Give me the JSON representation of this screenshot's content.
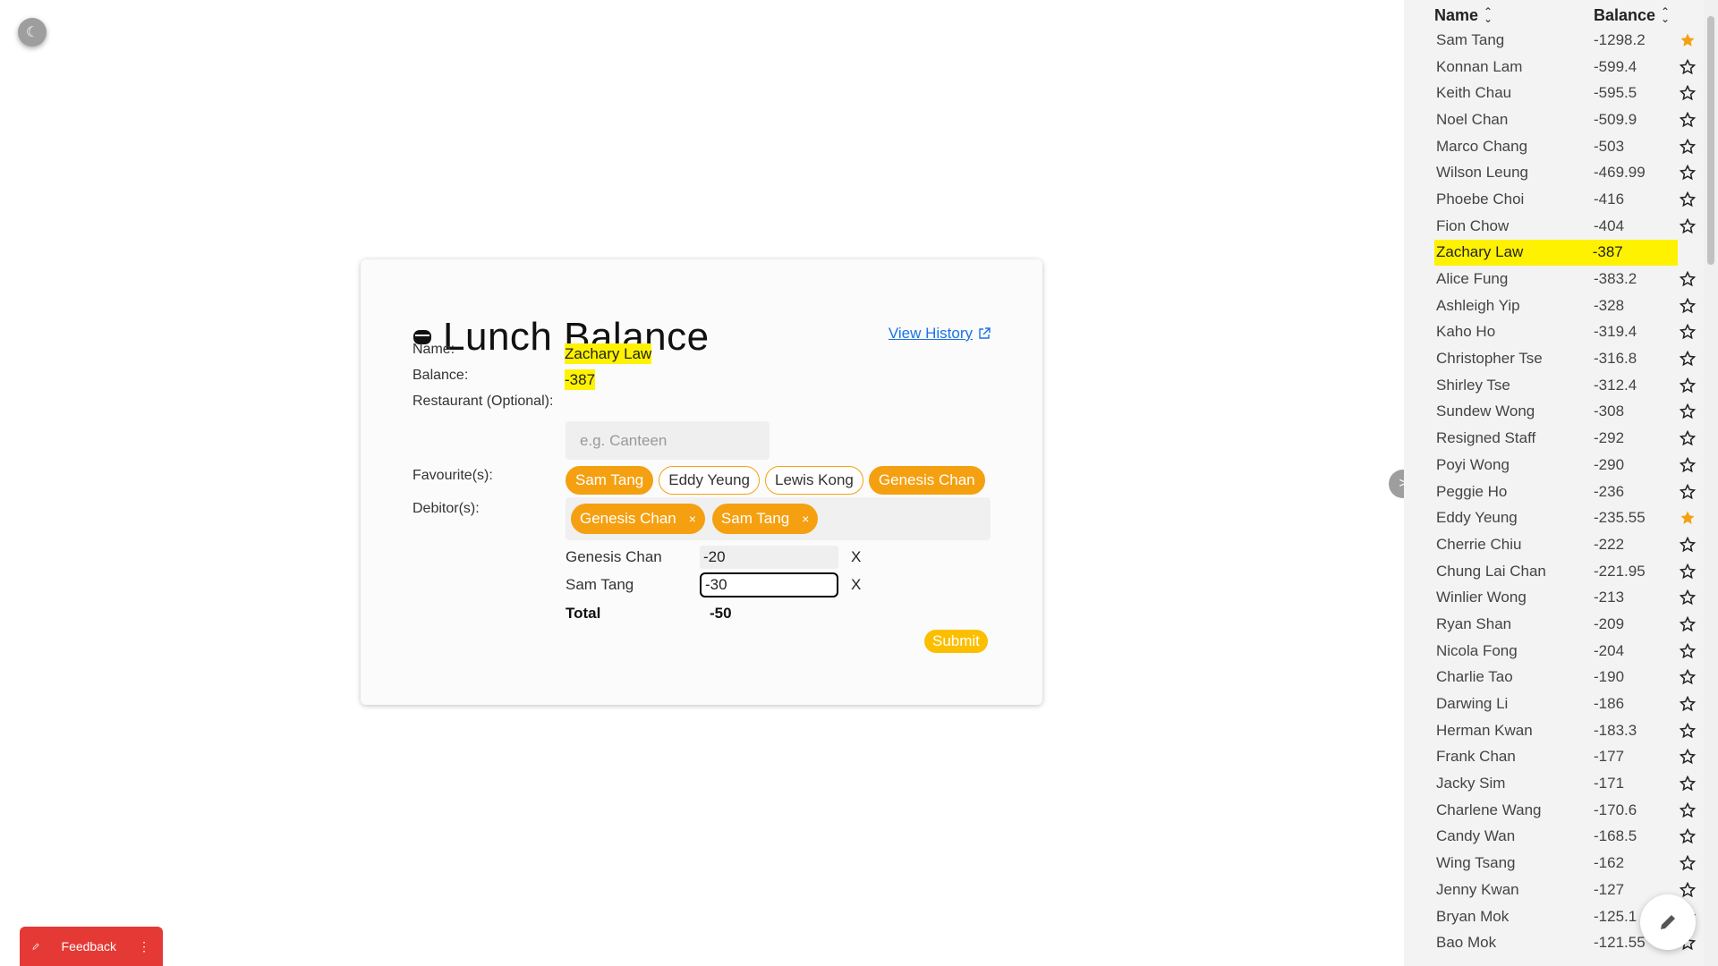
{
  "theme_toggle": {
    "icon": "moon-icon",
    "glyph": "☾"
  },
  "card": {
    "title": "Lunch Balance",
    "history_link": "View History",
    "name_label": "Name:",
    "name_value": "Zachary Law",
    "balance_label": "Balance:",
    "balance_value": "-387",
    "restaurant_label": "Restaurant (Optional):",
    "restaurant_placeholder": "e.g. Canteen",
    "favourites_label": "Favourite(s):",
    "favourites": [
      {
        "label": "Sam Tang",
        "selected": true
      },
      {
        "label": "Eddy Yeung",
        "selected": false
      },
      {
        "label": "Lewis Kong",
        "selected": false
      },
      {
        "label": "Genesis Chan",
        "selected": true
      }
    ],
    "debitors_label": "Debitor(s):",
    "debitors": [
      "Genesis Chan",
      "Sam Tang"
    ],
    "amounts": [
      {
        "name": "Genesis Chan",
        "value": "-20",
        "remove": "X"
      },
      {
        "name": "Sam Tang",
        "value": "-30",
        "remove": "X"
      }
    ],
    "total_label": "Total",
    "total_value": "-50",
    "submit_label": "Submit"
  },
  "side_toggle": {
    "glyph": ">"
  },
  "panel": {
    "header_name": "Name",
    "header_balance": "Balance",
    "rows": [
      {
        "name": "Sam Tang",
        "balance": "-1298.2",
        "star": "filled"
      },
      {
        "name": "Konnan Lam",
        "balance": "-599.4",
        "star": "outline"
      },
      {
        "name": "Keith Chau",
        "balance": "-595.5",
        "star": "outline"
      },
      {
        "name": "Noel Chan",
        "balance": "-509.9",
        "star": "outline"
      },
      {
        "name": "Marco Chang",
        "balance": "-503",
        "star": "outline"
      },
      {
        "name": "Wilson Leung",
        "balance": "-469.99",
        "star": "outline"
      },
      {
        "name": "Phoebe Choi",
        "balance": "-416",
        "star": "outline"
      },
      {
        "name": "Fion Chow",
        "balance": "-404",
        "star": "outline"
      },
      {
        "name": "Zachary Law",
        "balance": "-387",
        "star": "none",
        "selected": true
      },
      {
        "name": "Alice Fung",
        "balance": "-383.2",
        "star": "outline"
      },
      {
        "name": "Ashleigh Yip",
        "balance": "-328",
        "star": "outline"
      },
      {
        "name": "Kaho Ho",
        "balance": "-319.4",
        "star": "outline"
      },
      {
        "name": "Christopher Tse",
        "balance": "-316.8",
        "star": "outline"
      },
      {
        "name": "Shirley Tse",
        "balance": "-312.4",
        "star": "outline"
      },
      {
        "name": "Sundew Wong",
        "balance": "-308",
        "star": "outline"
      },
      {
        "name": "Resigned Staff",
        "balance": "-292",
        "star": "outline"
      },
      {
        "name": "Poyi Wong",
        "balance": "-290",
        "star": "outline"
      },
      {
        "name": "Peggie Ho",
        "balance": "-236",
        "star": "outline"
      },
      {
        "name": "Eddy Yeung",
        "balance": "-235.55",
        "star": "filled"
      },
      {
        "name": "Cherrie Chiu",
        "balance": "-222",
        "star": "outline"
      },
      {
        "name": "Chung Lai Chan",
        "balance": "-221.95",
        "star": "outline"
      },
      {
        "name": "Winlier Wong",
        "balance": "-213",
        "star": "outline"
      },
      {
        "name": "Ryan Shan",
        "balance": "-209",
        "star": "outline"
      },
      {
        "name": "Nicola Fong",
        "balance": "-204",
        "star": "outline"
      },
      {
        "name": "Charlie Tao",
        "balance": "-190",
        "star": "outline"
      },
      {
        "name": "Darwing Li",
        "balance": "-186",
        "star": "outline"
      },
      {
        "name": "Herman Kwan",
        "balance": "-183.3",
        "star": "outline"
      },
      {
        "name": "Frank Chan",
        "balance": "-177",
        "star": "outline"
      },
      {
        "name": "Jacky Sim",
        "balance": "-171",
        "star": "outline"
      },
      {
        "name": "Charlene Wang",
        "balance": "-170.6",
        "star": "outline"
      },
      {
        "name": "Candy Wan",
        "balance": "-168.5",
        "star": "outline"
      },
      {
        "name": "Wing Tsang",
        "balance": "-162",
        "star": "outline"
      },
      {
        "name": "Jenny Kwan",
        "balance": "-127",
        "star": "outline"
      },
      {
        "name": "Bryan Mok",
        "balance": "-125.1",
        "star": "outline"
      },
      {
        "name": "Bao Mok",
        "balance": "-121.55",
        "star": "outline"
      }
    ]
  },
  "feedback": {
    "label": "Feedback"
  },
  "colors": {
    "accent": "#f5a011",
    "highlight": "#fff200",
    "submit": "#fbbf00",
    "feedback": "#e53935",
    "link": "#1a73e8"
  }
}
